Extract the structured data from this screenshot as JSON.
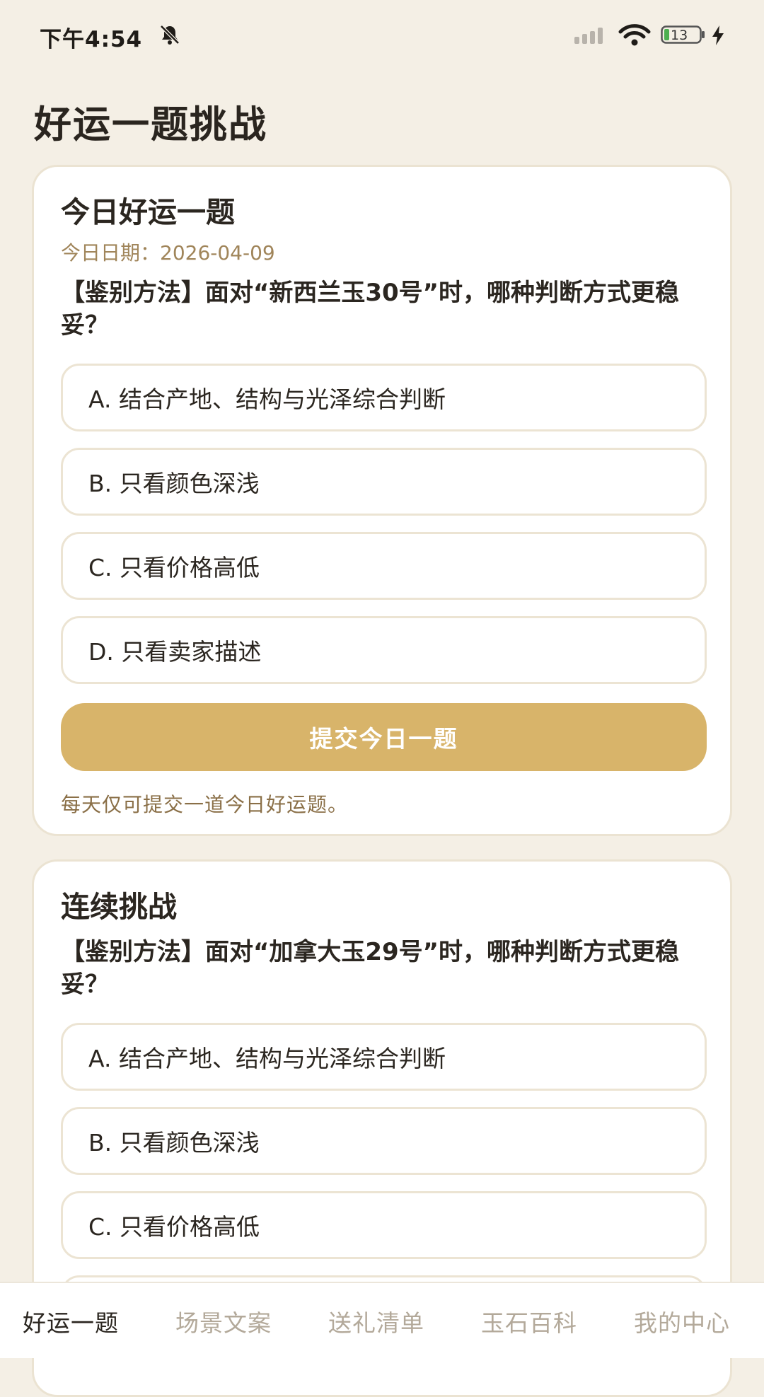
{
  "status_bar": {
    "time": "下午4:54",
    "battery": "13"
  },
  "page": {
    "title": "好运一题挑战"
  },
  "daily": {
    "title": "今日好运一题",
    "date": "今日日期：2026-04-09",
    "question": "【鉴别方法】面对“新西兰玉30号”时，哪种判断方式更稳妥？",
    "options": [
      "A. 结合产地、结构与光泽综合判断",
      "B. 只看颜色深浅",
      "C. 只看价格高低",
      "D. 只看卖家描述"
    ],
    "submit_label": "提交今日一题",
    "note": "每天仅可提交一道今日好运题。"
  },
  "streak": {
    "title": "连续挑战",
    "question": "【鉴别方法】面对“加拿大玉29号”时，哪种判断方式更稳妥？",
    "options": [
      "A. 结合产地、结构与光泽综合判断",
      "B. 只看颜色深浅",
      "C. 只看价格高低"
    ]
  },
  "nav": {
    "items": [
      "好运一题",
      "场景文案",
      "送礼清单",
      "玉石百科",
      "我的中心"
    ],
    "active_index": 0
  },
  "colors": {
    "background": "#f4efe5",
    "accent": "#d8b46a",
    "date_text": "#a0855a",
    "note_text": "#8a6f47"
  }
}
